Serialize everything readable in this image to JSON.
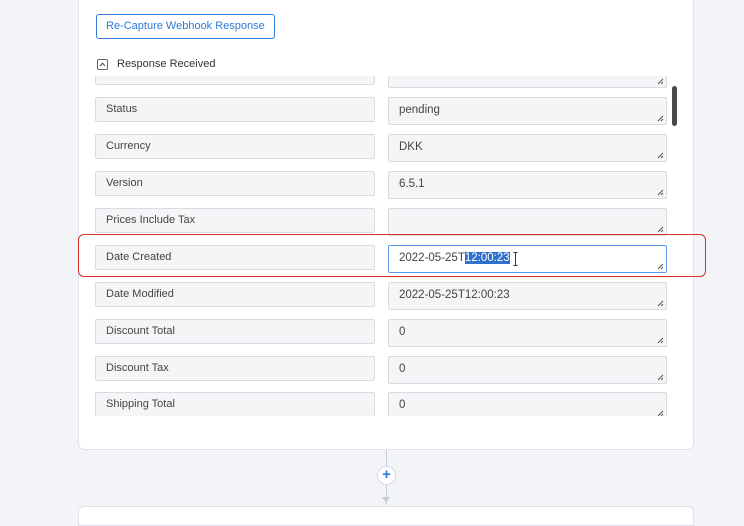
{
  "recapture_button": {
    "label": "Re-Capture Webhook Response"
  },
  "response_section": {
    "label": "Response Received",
    "expanded": true
  },
  "fields": [
    {
      "label": "",
      "value": ""
    },
    {
      "label": "Status",
      "value": "pending"
    },
    {
      "label": "Currency",
      "value": "DKK"
    },
    {
      "label": "Version",
      "value": "6.5.1"
    },
    {
      "label": "Prices Include Tax",
      "value": ""
    },
    {
      "label": "Date Created",
      "value_prefix": "2022-05-25T",
      "value_selected": "12:00:23"
    },
    {
      "label": "Date Modified",
      "value": "2022-05-25T12:00:23"
    },
    {
      "label": "Discount Total",
      "value": "0"
    },
    {
      "label": "Discount Tax",
      "value": "0"
    },
    {
      "label": "Shipping Total",
      "value": "0"
    }
  ],
  "colors": {
    "accent": "#2f7ad8",
    "highlight": "#d9302c",
    "selection": "#2e6fd0"
  }
}
